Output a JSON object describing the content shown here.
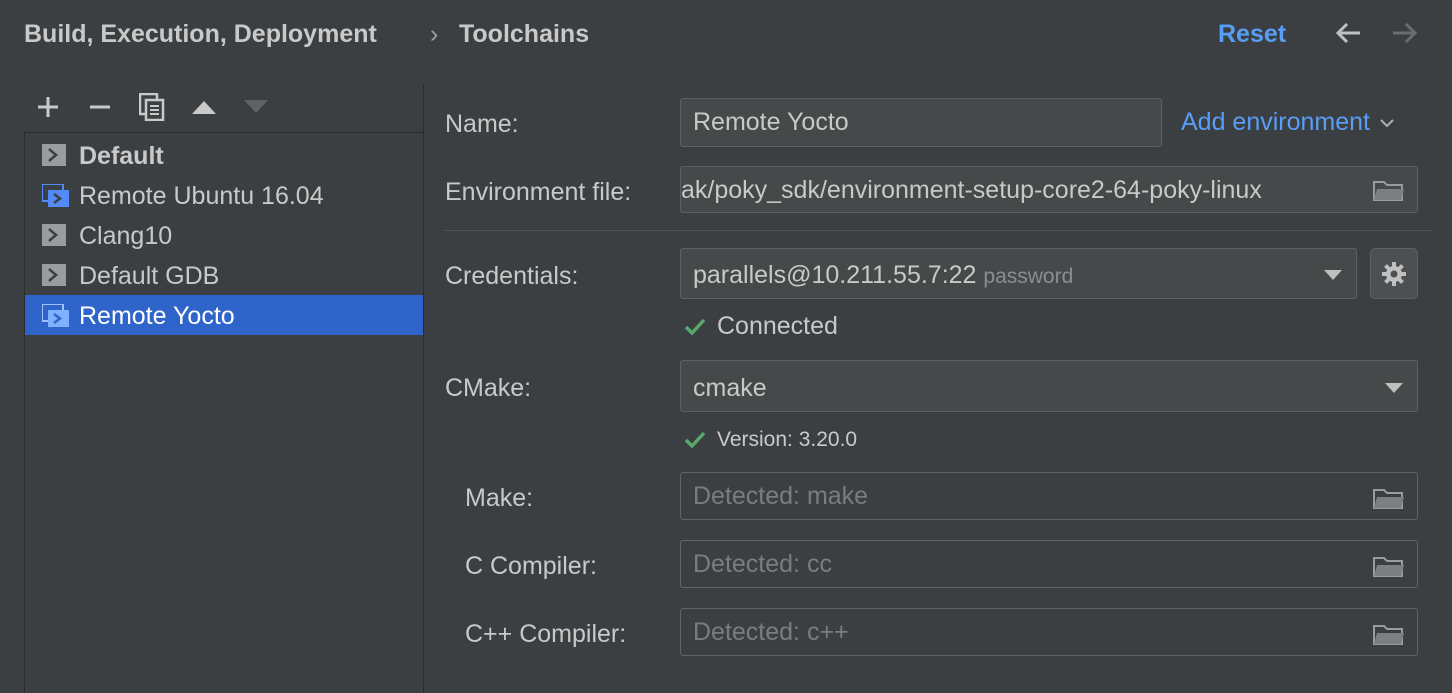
{
  "header": {
    "breadcrumb_parent": "Build, Execution, Deployment",
    "breadcrumb_separator": "›",
    "breadcrumb_current": "Toolchains",
    "reset_label": "Reset"
  },
  "toolbar": {
    "add": "+",
    "remove": "−"
  },
  "toolchains": [
    {
      "label": "Default",
      "icon": "terminal-icon",
      "bold": true
    },
    {
      "label": "Remote Ubuntu 16.04",
      "icon": "remote-host-icon"
    },
    {
      "label": "Clang10",
      "icon": "terminal-icon"
    },
    {
      "label": "Default GDB",
      "icon": "terminal-icon"
    },
    {
      "label": "Remote Yocto",
      "icon": "remote-host-icon",
      "selected": true
    }
  ],
  "form": {
    "name_label": "Name:",
    "name_value": "Remote Yocto",
    "add_environment_label": "Add environment",
    "env_file_label": "Environment file:",
    "env_file_value": "ak/poky_sdk/environment-setup-core2-64-poky-linux",
    "credentials_label": "Credentials:",
    "credentials_value": "parallels@10.211.55.7:22",
    "credentials_hint": "password",
    "connection_status": "Connected",
    "cmake_label": "CMake:",
    "cmake_value": "cmake",
    "cmake_version": "Version: 3.20.0",
    "make_label": "Make:",
    "make_placeholder": "Detected: make",
    "c_compiler_label": "C Compiler:",
    "c_compiler_placeholder": "Detected: cc",
    "cpp_compiler_label": "C++ Compiler:",
    "cpp_compiler_placeholder": "Detected: c++"
  },
  "colors": {
    "background": "#3c3f41",
    "accent": "#589df6",
    "selection": "#2f65ca",
    "success": "#59a869"
  }
}
